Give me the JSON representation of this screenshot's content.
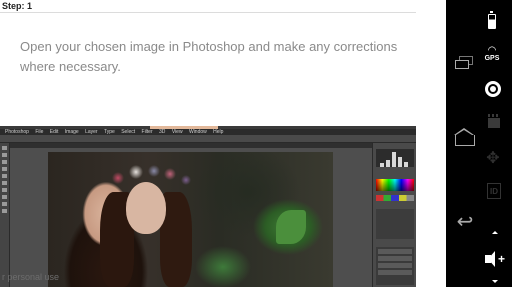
{
  "step": {
    "label": "Step: 1"
  },
  "instruction": {
    "text": "Open your chosen image in Photoshop and make any corrections where necessary."
  },
  "photoshop_screenshot": {
    "menu_items": [
      "Photoshop",
      "File",
      "Edit",
      "Image",
      "Layer",
      "Type",
      "Select",
      "Filter",
      "3D",
      "View",
      "Window",
      "Help"
    ]
  },
  "watermark": {
    "text": "r personal use"
  },
  "system_bar": {
    "icons": [
      "battery-icon",
      "gps-icon",
      "recent-apps-icon",
      "camera-icon",
      "home-icon",
      "clapper-icon",
      "dpad-icon",
      "id-icon",
      "back-icon",
      "scroll-up-icon",
      "volume-up-icon",
      "scroll-down-icon"
    ],
    "gps_label": "GPS",
    "id_label": "ID",
    "volume_label": "+"
  }
}
